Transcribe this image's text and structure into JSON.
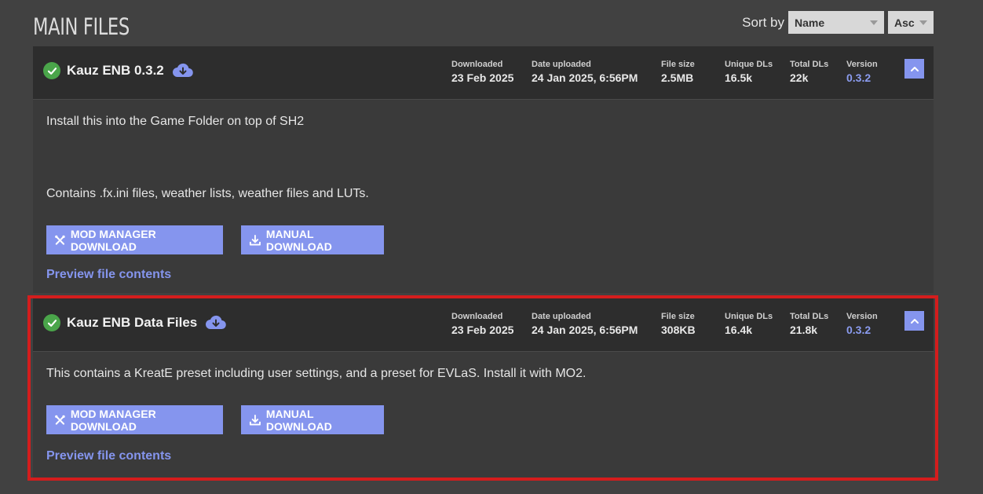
{
  "section": {
    "title": "MAIN FILES"
  },
  "sort": {
    "label": "Sort by",
    "field_value": "Name",
    "order_value": "Asc"
  },
  "meta_labels": {
    "downloaded": "Downloaded",
    "date_uploaded": "Date uploaded",
    "file_size": "File size",
    "unique_dls": "Unique DLs",
    "total_dls": "Total DLs",
    "version": "Version"
  },
  "buttons": {
    "mod_manager": "MOD MANAGER DOWNLOAD",
    "manual": "MANUAL DOWNLOAD",
    "preview": "Preview file contents"
  },
  "files": [
    {
      "name": "Kauz ENB 0.3.2",
      "downloaded": "23 Feb 2025",
      "date_uploaded": "24 Jan 2025, 6:56PM",
      "file_size": "2.5MB",
      "unique_dls": "16.5k",
      "total_dls": "22k",
      "version": "0.3.2",
      "desc_1": "Install this into the Game Folder on top of SH2",
      "desc_2": "Contains .fx.ini files, weather lists, weather files and LUTs."
    },
    {
      "name": "Kauz ENB Data Files",
      "downloaded": "23 Feb 2025",
      "date_uploaded": "24 Jan 2025, 6:56PM",
      "file_size": "308KB",
      "unique_dls": "16.4k",
      "total_dls": "21.8k",
      "version": "0.3.2",
      "desc_1": "This contains a KreatE preset including user settings, and a preset for EVLaS. Install it with MO2."
    }
  ],
  "colors": {
    "accent": "#8595ee",
    "check": "#4aa54a",
    "highlight": "#d41d1d",
    "header_bg": "#2d2d2d",
    "body_bg": "#3a3a3a",
    "page_bg": "#414141"
  }
}
